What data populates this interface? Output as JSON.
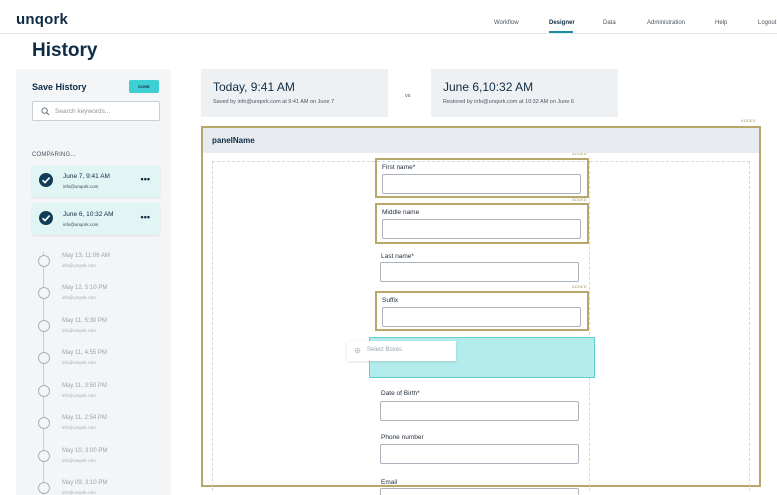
{
  "app": {
    "logo": "unqork"
  },
  "nav": {
    "items": [
      {
        "label": "Workflow",
        "active": false
      },
      {
        "label": "Designer",
        "active": true
      },
      {
        "label": "Data",
        "active": false
      },
      {
        "label": "Administration",
        "active": false
      },
      {
        "label": "Help",
        "active": false
      },
      {
        "label": "Logout",
        "active": false
      }
    ]
  },
  "page": {
    "title": "History"
  },
  "sidebar": {
    "title": "Save History",
    "done_label": "DONE",
    "search_placeholder": "Search keywords...",
    "comparing_label": "COMPARING...",
    "comparing": [
      {
        "date": "June 7, 9:41 AM",
        "email": "info@unqork.com"
      },
      {
        "date": "June 6, 10:32 AM",
        "email": "info@unqork.com"
      }
    ],
    "history": [
      {
        "date": "May 13, 11:06 AM",
        "email": "info@unqork.com"
      },
      {
        "date": "May 12, 5:10 PM",
        "email": "info@unqork.com"
      },
      {
        "date": "May 11, 5:30 PM",
        "email": "info@unqork.com"
      },
      {
        "date": "May 11, 4:55 PM",
        "email": "info@unqork.com"
      },
      {
        "date": "May 11, 3:50 PM",
        "email": "info@unqork.com"
      },
      {
        "date": "May 11, 2:54 PM",
        "email": "info@unqork.com"
      },
      {
        "date": "May 10, 3:00 PM",
        "email": "info@unqork.com"
      },
      {
        "date": "May 09, 3:10 PM",
        "email": "info@unqork.com"
      }
    ]
  },
  "versions": {
    "left": {
      "title": "Today, 9:41 AM",
      "subtitle": "Saved by info@unqork.com at 9:41 AM on June 7"
    },
    "vs": "vs",
    "right": {
      "title": "June 6,10:32 AM",
      "subtitle": "Restored by info@unqork.com at 10:32 AM on June 6"
    }
  },
  "panel": {
    "added_label": "ADDED",
    "name": "panelName",
    "select_boxes_label": "Select Boxes",
    "fields": [
      {
        "label": "First name*",
        "added": true
      },
      {
        "label": "Middle name",
        "added": true
      },
      {
        "label": "Last name*",
        "added": false
      },
      {
        "label": "Suffix",
        "added": true
      },
      {
        "label": "Date of Birth*",
        "added": false
      },
      {
        "label": "Phone number",
        "added": false
      },
      {
        "label": "Email",
        "added": false
      }
    ]
  },
  "colors": {
    "brand": "#0f2c44",
    "accent": "#3fd0d6",
    "added_border": "#b7a86a",
    "check": "#0f3d57"
  }
}
